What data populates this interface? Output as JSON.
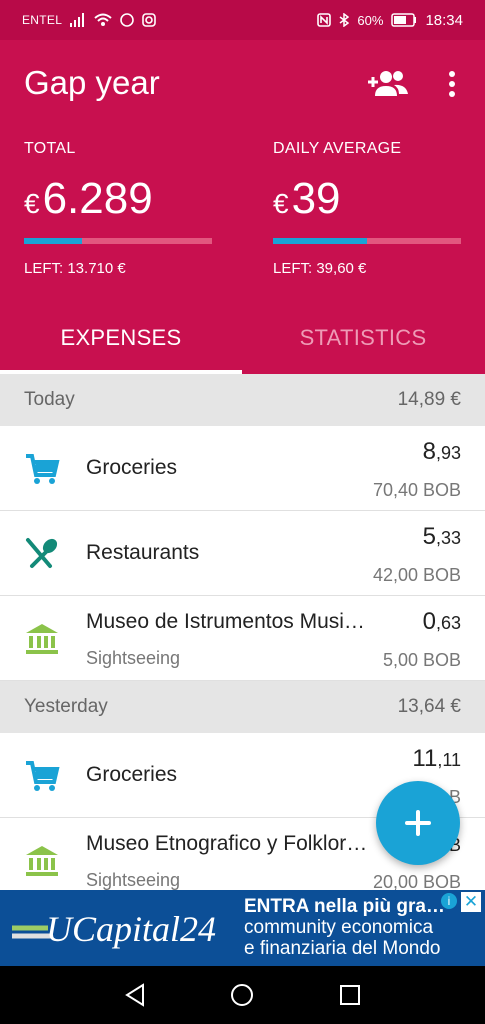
{
  "status_bar": {
    "carrier": "ENTEL",
    "battery": "60%",
    "time": "18:34"
  },
  "header": {
    "title": "Gap year"
  },
  "stats": {
    "total": {
      "label": "TOTAL",
      "currency": "€",
      "value": "6.289",
      "left": "LEFT: 13.710 €",
      "progress": 0.31
    },
    "daily": {
      "label": "DAILY AVERAGE",
      "currency": "€",
      "value": "39",
      "left": "LEFT: 39,60 €",
      "progress": 0.5
    }
  },
  "tabs": [
    {
      "label": "EXPENSES",
      "active": true
    },
    {
      "label": "STATISTICS",
      "active": false
    }
  ],
  "sections": [
    {
      "label": "Today",
      "total": "14,89 €",
      "items": [
        {
          "name": "Groceries",
          "icon": "cart-icon",
          "amount_int": "8",
          "amount_dec": ",93",
          "original": "70,40 BOB"
        },
        {
          "name": "Restaurants",
          "icon": "fork-spoon-icon",
          "amount_int": "5",
          "amount_dec": ",33",
          "original": "42,00 BOB"
        },
        {
          "name": "Museo de Istrumentos Musi…",
          "sub": "Sightseeing",
          "icon": "museum-icon",
          "amount_int": "0",
          "amount_dec": ",63",
          "original": "5,00 BOB"
        }
      ]
    },
    {
      "label": "Yesterday",
      "total": "13,64 €",
      "items": [
        {
          "name": "Groceries",
          "icon": "cart-icon",
          "amount_int": "11",
          "amount_dec": ",11",
          "original": "87,…B"
        },
        {
          "name": "Museo Etnografico y Folklor…",
          "sub": "Sightseeing",
          "icon": "museum-icon",
          "amount_int": "",
          "amount_dec": ",…B",
          "original": "20,00 BOB"
        }
      ]
    }
  ],
  "ad": {
    "logo": "UCapital24",
    "line1": "ENTRA nella più gra…",
    "line2": "community economica",
    "line3": "e finanziaria del Mondo",
    "close": "✕",
    "info": "i"
  },
  "colors": {
    "header": "#c8104f",
    "status": "#b80a48",
    "accent": "#1aa3d6",
    "cart": "#1aa3d6",
    "restaurant": "#138a78",
    "museum": "#8bc34a"
  }
}
